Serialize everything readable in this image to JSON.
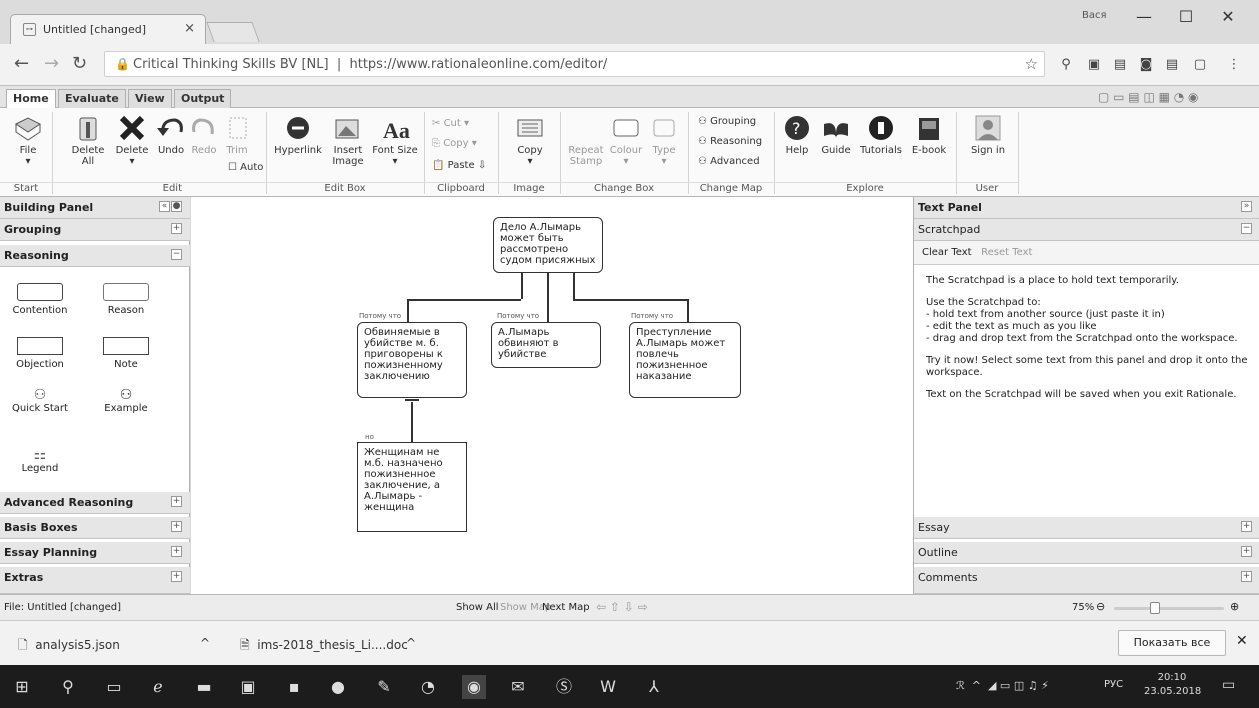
{
  "browser": {
    "tab_title": "Untitled [changed]",
    "tab_close": "×",
    "user_label": "Вася",
    "win_min": "—",
    "win_max": "☐",
    "win_close": "✕",
    "url_site": "Critical Thinking Skills BV [NL]",
    "url": "https://www.rationaleonline.com/editor/"
  },
  "ribbon_tabs": [
    "Home",
    "Evaluate",
    "View",
    "Output"
  ],
  "ribbon": {
    "file": "File",
    "delete_all": "Delete All",
    "delete": "Delete",
    "undo": "Undo",
    "redo": "Redo",
    "trim": "Trim",
    "auto": "Auto",
    "hyperlink": "Hyperlink",
    "insert_image": "Insert Image",
    "font_size": "Font Size",
    "cut": "Cut",
    "copy_small": "Copy",
    "paste": "Paste",
    "copy": "Copy",
    "repeat_stamp": "Repeat Stamp",
    "colour": "Colour",
    "type": "Type",
    "grouping": "Grouping",
    "reasoning": "Reasoning",
    "advanced": "Advanced",
    "help": "Help",
    "guide": "Guide",
    "tutorials": "Tutorials",
    "ebook": "E-book",
    "sign_in": "Sign in",
    "groups": {
      "start": "Start",
      "edit": "Edit",
      "edit_box": "Edit Box",
      "clipboard": "Clipboard",
      "image": "Image",
      "change_box": "Change Box",
      "change_map": "Change Map",
      "explore": "Explore",
      "user": "User"
    }
  },
  "left_panel": {
    "title": "Building Panel",
    "sections": {
      "grouping": "Grouping",
      "reasoning": "Reasoning",
      "advanced": "Advanced Reasoning",
      "basis": "Basis Boxes",
      "essay": "Essay Planning",
      "extras": "Extras"
    },
    "tools": {
      "contention": "Contention",
      "reason": "Reason",
      "objection": "Objection",
      "note": "Note",
      "quick_start": "Quick Start",
      "example": "Example",
      "legend": "Legend"
    }
  },
  "map": {
    "root": "Дело А.Лымарь может быть рассмотрено судом присяжных",
    "reason1": "Обвиняемые в убийстве м. б. приговорены к пожизненному заключению",
    "reason2": "А.Лымарь обвиняют в убийстве",
    "reason3": "Преступление А.Лымарь может повлечь пожизненное наказание",
    "objection": "Женщинам не м.б. назначено пожизненное заключение, а А.Лымарь - женщина",
    "because": "Потому что",
    "but": "но"
  },
  "right_panel": {
    "title": "Text Panel",
    "scratchpad": "Scratchpad",
    "clear_text": "Clear Text",
    "reset_text": "Reset Text",
    "p1": "The Scratchpad is a place to hold text temporarily.",
    "p2_title": "Use the Scratchpad to:",
    "p2_l1": "- hold text from another source (just paste it in)",
    "p2_l2": "- edit the text as much as you like",
    "p2_l3": "- drag and drop text from the Scratchpad onto the workspace.",
    "p3": "Try it now!  Select some text from this panel and drop it onto the workspace.",
    "p4": "Text on the Scratchpad will be saved when you exit Rationale.",
    "essay": "Essay",
    "outline": "Outline",
    "comments": "Comments"
  },
  "status": {
    "file": "File: Untitled [changed]",
    "show_all": "Show All",
    "show_map": "Show Map",
    "next_map": "Next Map",
    "zoom": "75%"
  },
  "downloads": {
    "file1": "analysis5.json",
    "file2": "ims-2018_thesis_Li....doc",
    "show_all": "Показать все"
  },
  "taskbar": {
    "lang": "РУС",
    "time": "20:10",
    "date": "23.05.2018"
  }
}
